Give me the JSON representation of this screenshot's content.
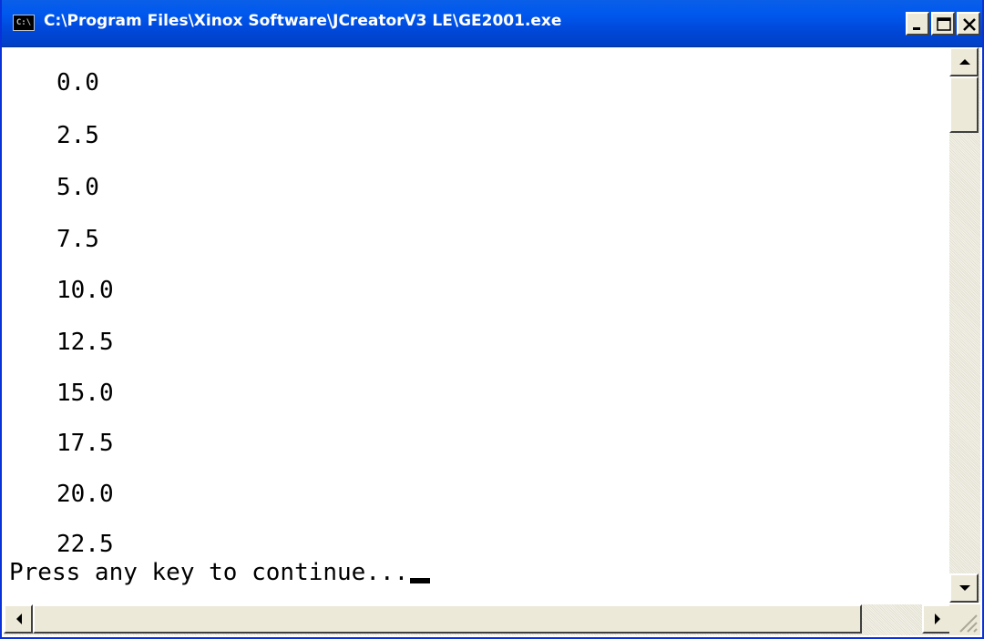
{
  "window": {
    "title": "C:\\Program Files\\Xinox Software\\JCreatorV3 LE\\GE2001.exe",
    "icon": "console-icon",
    "icon_text": "C:\\"
  },
  "console": {
    "lines": [
      "0.0",
      "2.5",
      "5.0",
      "7.5",
      "10.0",
      "12.5",
      "15.0",
      "17.5",
      "20.0",
      "22.5"
    ],
    "prompt": "Press any key to continue..."
  },
  "colors": {
    "titlebar": "#0058ee",
    "background": "#ffffff",
    "text": "#000000"
  }
}
